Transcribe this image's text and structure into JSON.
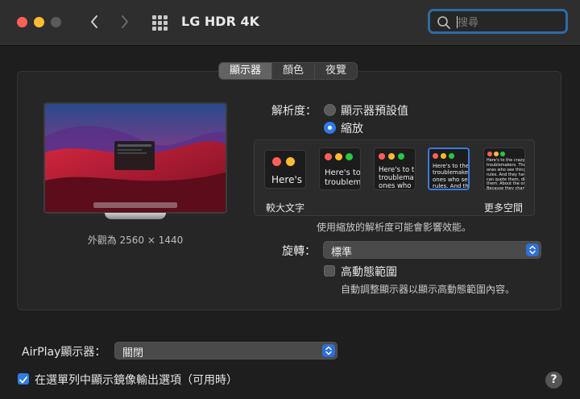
{
  "window": {
    "title": "LG HDR 4K"
  },
  "search": {
    "placeholder": "搜尋"
  },
  "tabs": [
    {
      "label": "顯示器",
      "active": true
    },
    {
      "label": "顏色",
      "active": false
    },
    {
      "label": "夜覽",
      "active": false
    }
  ],
  "display": {
    "size_caption": "外觀為 2560 × 1440"
  },
  "resolution": {
    "label": "解析度：",
    "options": [
      {
        "label": "顯示器預設值",
        "selected": false
      },
      {
        "label": "縮放",
        "selected": true
      }
    ],
    "scale_thumbs": [
      {
        "text": "Here's",
        "selected": false
      },
      {
        "text": "Here's to\ntroublem",
        "selected": false
      },
      {
        "text": "Here's to t\ntroublema\nones who",
        "selected": false
      },
      {
        "text": "Here's to the cr\ntroublemakers.\nones who see t\nrules. And they",
        "selected": true
      },
      {
        "text": "Here's to the crazy one\ntroublemakers. The rou\nones who see things di\nrules. And they have no\ncan quote them, disagr\nthem. About the only th\nBecause they change th",
        "selected": false
      }
    ],
    "scale_min_label": "較大文字",
    "scale_max_label": "更多空間",
    "note": "使用縮放的解析度可能會影響效能。"
  },
  "rotation": {
    "label": "旋轉：",
    "value": "標準"
  },
  "hdr": {
    "label": "高動態範圍",
    "checked": false,
    "note": "自動調整顯示器以顯示高動態範圍內容。"
  },
  "airplay": {
    "label": "AirPlay顯示器：",
    "value": "關閉"
  },
  "mirror_option": {
    "label": "在選單列中顯示鏡像輸出選項（可用時）",
    "checked": true
  },
  "help": {
    "label": "?"
  },
  "colors": {
    "accent": "#2f7ce8",
    "close": "#ff5f57",
    "minimize": "#febc2e"
  }
}
